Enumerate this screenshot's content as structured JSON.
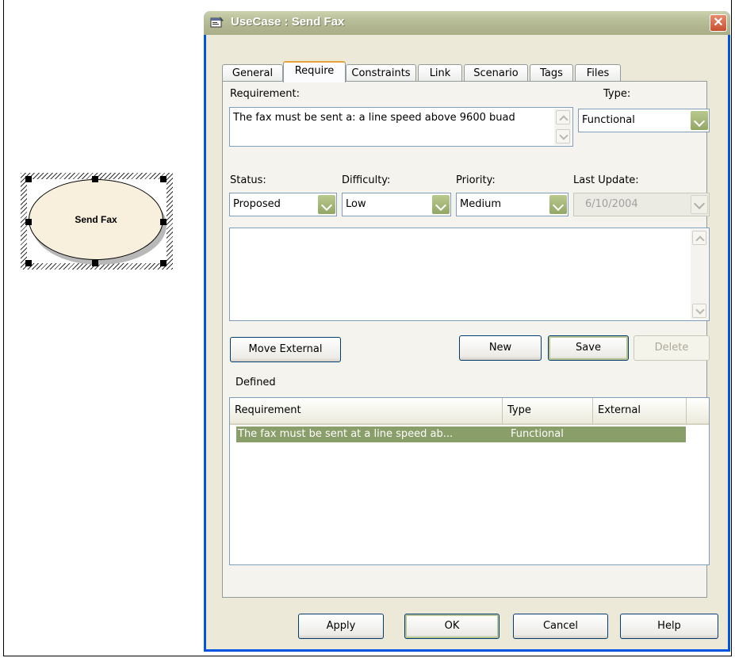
{
  "diagram": {
    "shape_label": "Send Fax"
  },
  "dialog": {
    "title": "UseCase : Send Fax",
    "close_glyph": "✕",
    "tabs": [
      "General",
      "Require",
      "Constraints",
      "Link",
      "Scenario",
      "Tags",
      "Files"
    ],
    "active_tab": "Require",
    "requirement_label": "Requirement:",
    "requirement_text": "The fax must be sent a: a line speed above 9600 buad",
    "type_label": "Type:",
    "type_value": "Functional",
    "status_label": "Status:",
    "status_value": "Proposed",
    "difficulty_label": "Difficulty:",
    "difficulty_value": "Low",
    "priority_label": "Priority:",
    "priority_value": "Medium",
    "last_update_label": "Last Update:",
    "last_update_value": "6/10/2004",
    "notes_text": "",
    "buttons": {
      "move_external": "Move External",
      "new_label": "New",
      "save_label": "Save",
      "delete_label": "Delete"
    },
    "defined_label": "Defined",
    "table": {
      "columns": [
        "Requirement",
        "Type",
        "External"
      ],
      "rows": [
        {
          "requirement": "The fax must be sent at a line speed ab...",
          "type": "Functional",
          "external": ""
        }
      ]
    },
    "footer": {
      "apply": "Apply",
      "ok": "OK",
      "cancel": "Cancel",
      "help": "Help"
    }
  },
  "colors": {
    "accent_selection": "#8a9e6a",
    "title_bar": "#b7bd97",
    "combo_button": "#97b2dd"
  }
}
